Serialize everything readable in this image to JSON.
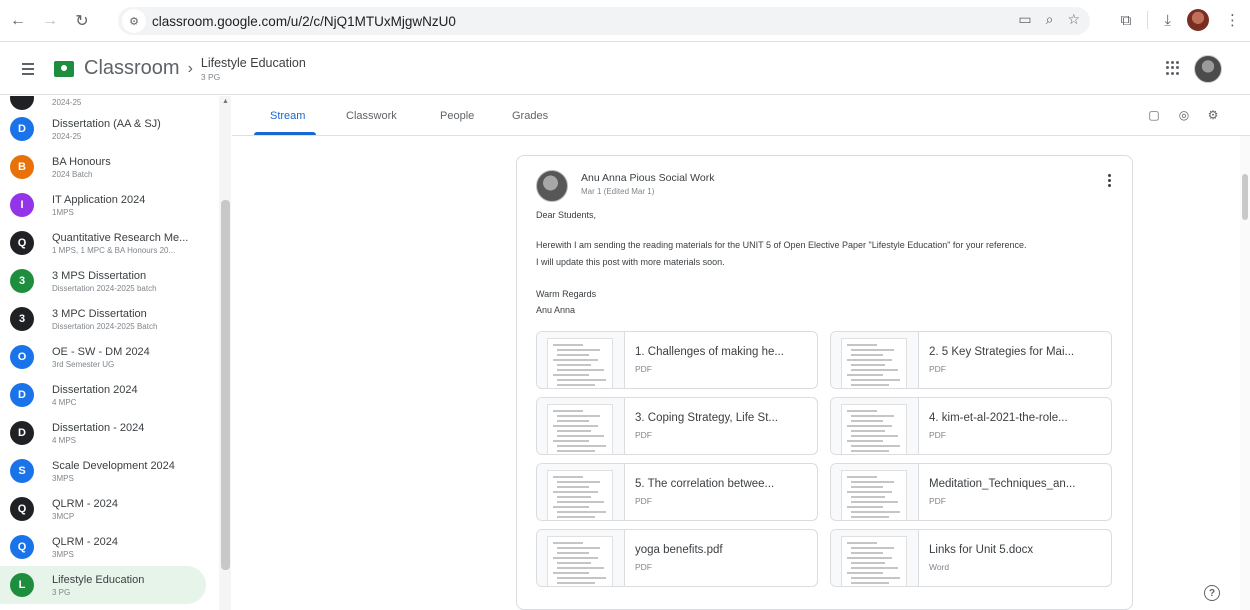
{
  "browser": {
    "url": "classroom.google.com/u/2/c/NjQ1MTUxMjgwNzU0"
  },
  "header": {
    "app_name": "Classroom",
    "breadcrumb_sep": "›",
    "course_title": "Lifestyle Education",
    "course_subtitle": "3 PG"
  },
  "sidebar": {
    "items": [
      {
        "letter": "",
        "name": "",
        "sub": "2024-25",
        "color": "#202124"
      },
      {
        "letter": "D",
        "name": "Dissertation (AA & SJ)",
        "sub": "2024-25",
        "color": "#1a73e8"
      },
      {
        "letter": "B",
        "name": "BA Honours",
        "sub": "2024 Batch",
        "color": "#e8710a"
      },
      {
        "letter": "I",
        "name": "IT Application 2024",
        "sub": "1MPS",
        "color": "#9334e6"
      },
      {
        "letter": "Q",
        "name": "Quantitative Research Me...",
        "sub": "1 MPS, 1 MPC & BA Honours 20...",
        "color": "#202124"
      },
      {
        "letter": "3",
        "name": "3 MPS Dissertation",
        "sub": "Dissertation 2024-2025 batch",
        "color": "#1e8e3e"
      },
      {
        "letter": "3",
        "name": "3 MPC Dissertation",
        "sub": "Dissertation 2024-2025 Batch",
        "color": "#202124"
      },
      {
        "letter": "O",
        "name": "OE - SW - DM 2024",
        "sub": "3rd Semester UG",
        "color": "#1a73e8"
      },
      {
        "letter": "D",
        "name": "Dissertation 2024",
        "sub": "4 MPC",
        "color": "#1a73e8"
      },
      {
        "letter": "D",
        "name": "Dissertation - 2024",
        "sub": "4 MPS",
        "color": "#202124"
      },
      {
        "letter": "S",
        "name": "Scale Development 2024",
        "sub": "3MPS",
        "color": "#1a73e8"
      },
      {
        "letter": "Q",
        "name": "QLRM - 2024",
        "sub": "3MCP",
        "color": "#202124"
      },
      {
        "letter": "Q",
        "name": "QLRM - 2024",
        "sub": "3MPS",
        "color": "#1a73e8"
      },
      {
        "letter": "L",
        "name": "Lifestyle Education",
        "sub": "3 PG",
        "color": "#1e8e3e"
      }
    ]
  },
  "tabs": [
    {
      "label": "Stream"
    },
    {
      "label": "Classwork"
    },
    {
      "label": "People"
    },
    {
      "label": "Grades"
    }
  ],
  "post": {
    "author": "Anu Anna Pious Social Work",
    "date": "Mar 1 (Edited Mar 1)",
    "lines": [
      "Dear Students,",
      "Herewith I am sending the reading materials for the UNIT 5 of Open Elective Paper \"Lifestyle Education\" for your reference.",
      "I will update this post with more materials soon.",
      "Warm Regards",
      "Anu Anna"
    ],
    "attachments": [
      {
        "title": "1. Challenges of making he...",
        "type": "PDF"
      },
      {
        "title": "2. 5 Key Strategies for Mai...",
        "type": "PDF"
      },
      {
        "title": "3. Coping Strategy, Life St...",
        "type": "PDF"
      },
      {
        "title": "4. kim-et-al-2021-the-role...",
        "type": "PDF"
      },
      {
        "title": "5. The correlation betwee...",
        "type": "PDF"
      },
      {
        "title": "Meditation_Techniques_an...",
        "type": "PDF"
      },
      {
        "title": "yoga benefits.pdf",
        "type": "PDF"
      },
      {
        "title": "Links for Unit 5.docx",
        "type": "Word"
      }
    ]
  },
  "icons": {
    "back": "back-arrow-icon",
    "forward": "forward-arrow-icon",
    "reload": "reload-icon",
    "help": "help-icon"
  }
}
